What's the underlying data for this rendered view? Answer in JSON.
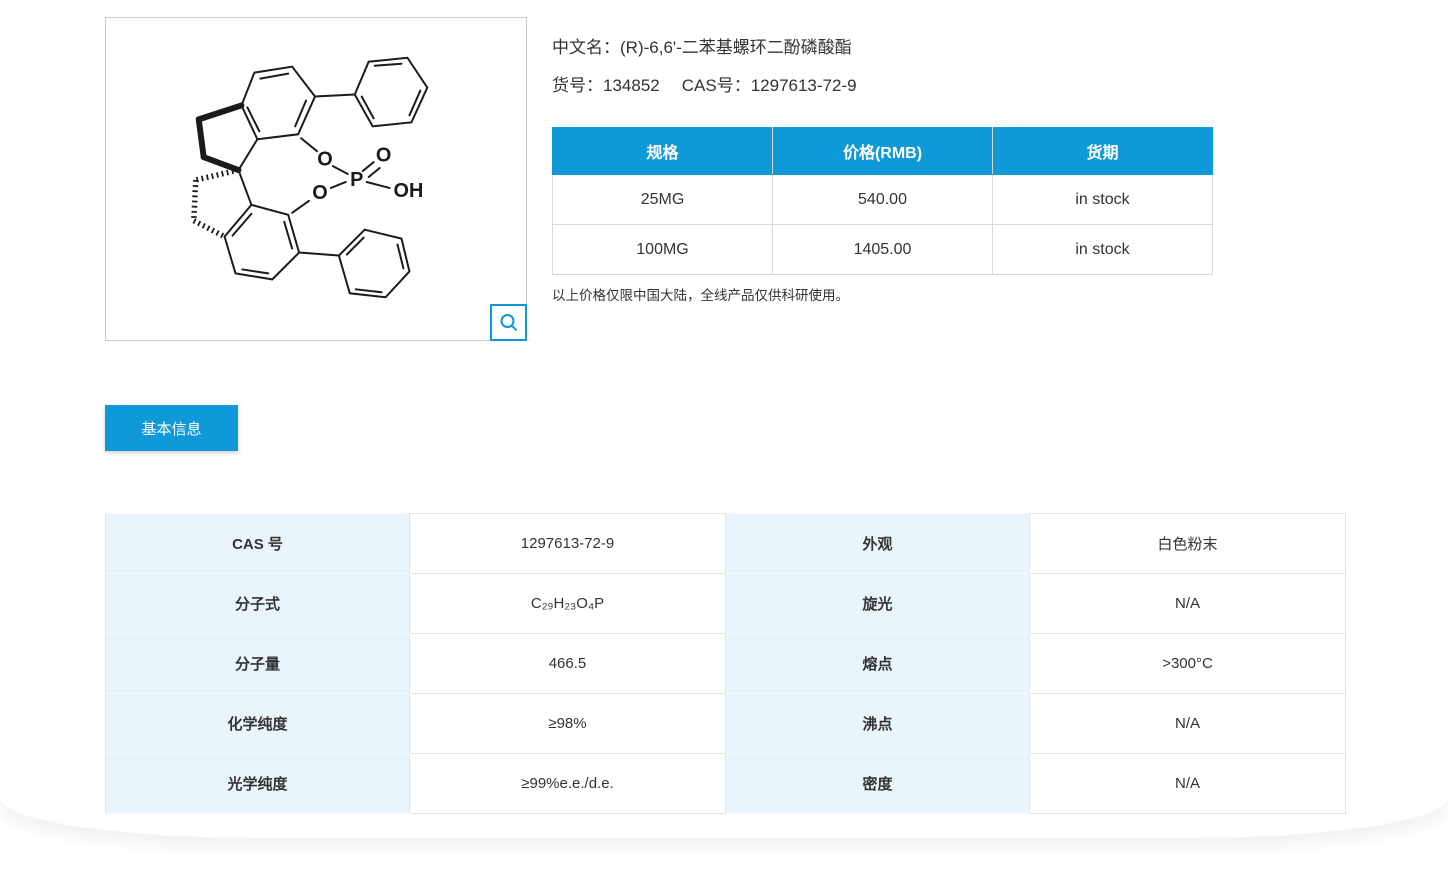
{
  "colors": {
    "accent_blue": "#0f99d8",
    "icon_blue": "#1296db",
    "label_cell_bg": "#e9f5fc",
    "border_grey": "#d9d9d9",
    "text": "#333333"
  },
  "product": {
    "name_label": "中文名：",
    "name": "(R)-6,6'-二苯基螺环二酚磷酸酯",
    "catalog_label": "货号：",
    "catalog_number": "134852",
    "cas_label": "CAS号：",
    "cas_number": "1297613-72-9"
  },
  "structure": {
    "atoms": {
      "o_top": "O",
      "o_bottom": "O",
      "p": "P",
      "o_double": "O",
      "oh": "OH"
    },
    "zoom_icon": "magnifier-icon"
  },
  "price_table": {
    "headers": [
      "规格",
      "价格(RMB)",
      "货期"
    ],
    "rows": [
      {
        "spec": "25MG",
        "price": "540.00",
        "stock": "in stock"
      },
      {
        "spec": "100MG",
        "price": "1405.00",
        "stock": "in stock"
      }
    ],
    "note": "以上价格仅限中国大陆，全线产品仅供科研使用。"
  },
  "tabs": {
    "basic_info": "基本信息"
  },
  "properties": {
    "rows": [
      {
        "label1": "CAS 号",
        "value1": "1297613-72-9",
        "label2": "外观",
        "value2": "白色粉末"
      },
      {
        "label1": "分子式",
        "value1": "C₂₉H₂₃O₄P",
        "label2": "旋光",
        "value2": "N/A"
      },
      {
        "label1": "分子量",
        "value1": "466.5",
        "label2": "熔点",
        "value2": ">300°C"
      },
      {
        "label1": "化学纯度",
        "value1": "≥98%",
        "label2": "沸点",
        "value2": "N/A"
      },
      {
        "label1": "光学纯度",
        "value1": "≥99%e.e./d.e.",
        "label2": "密度",
        "value2": "N/A"
      }
    ]
  }
}
